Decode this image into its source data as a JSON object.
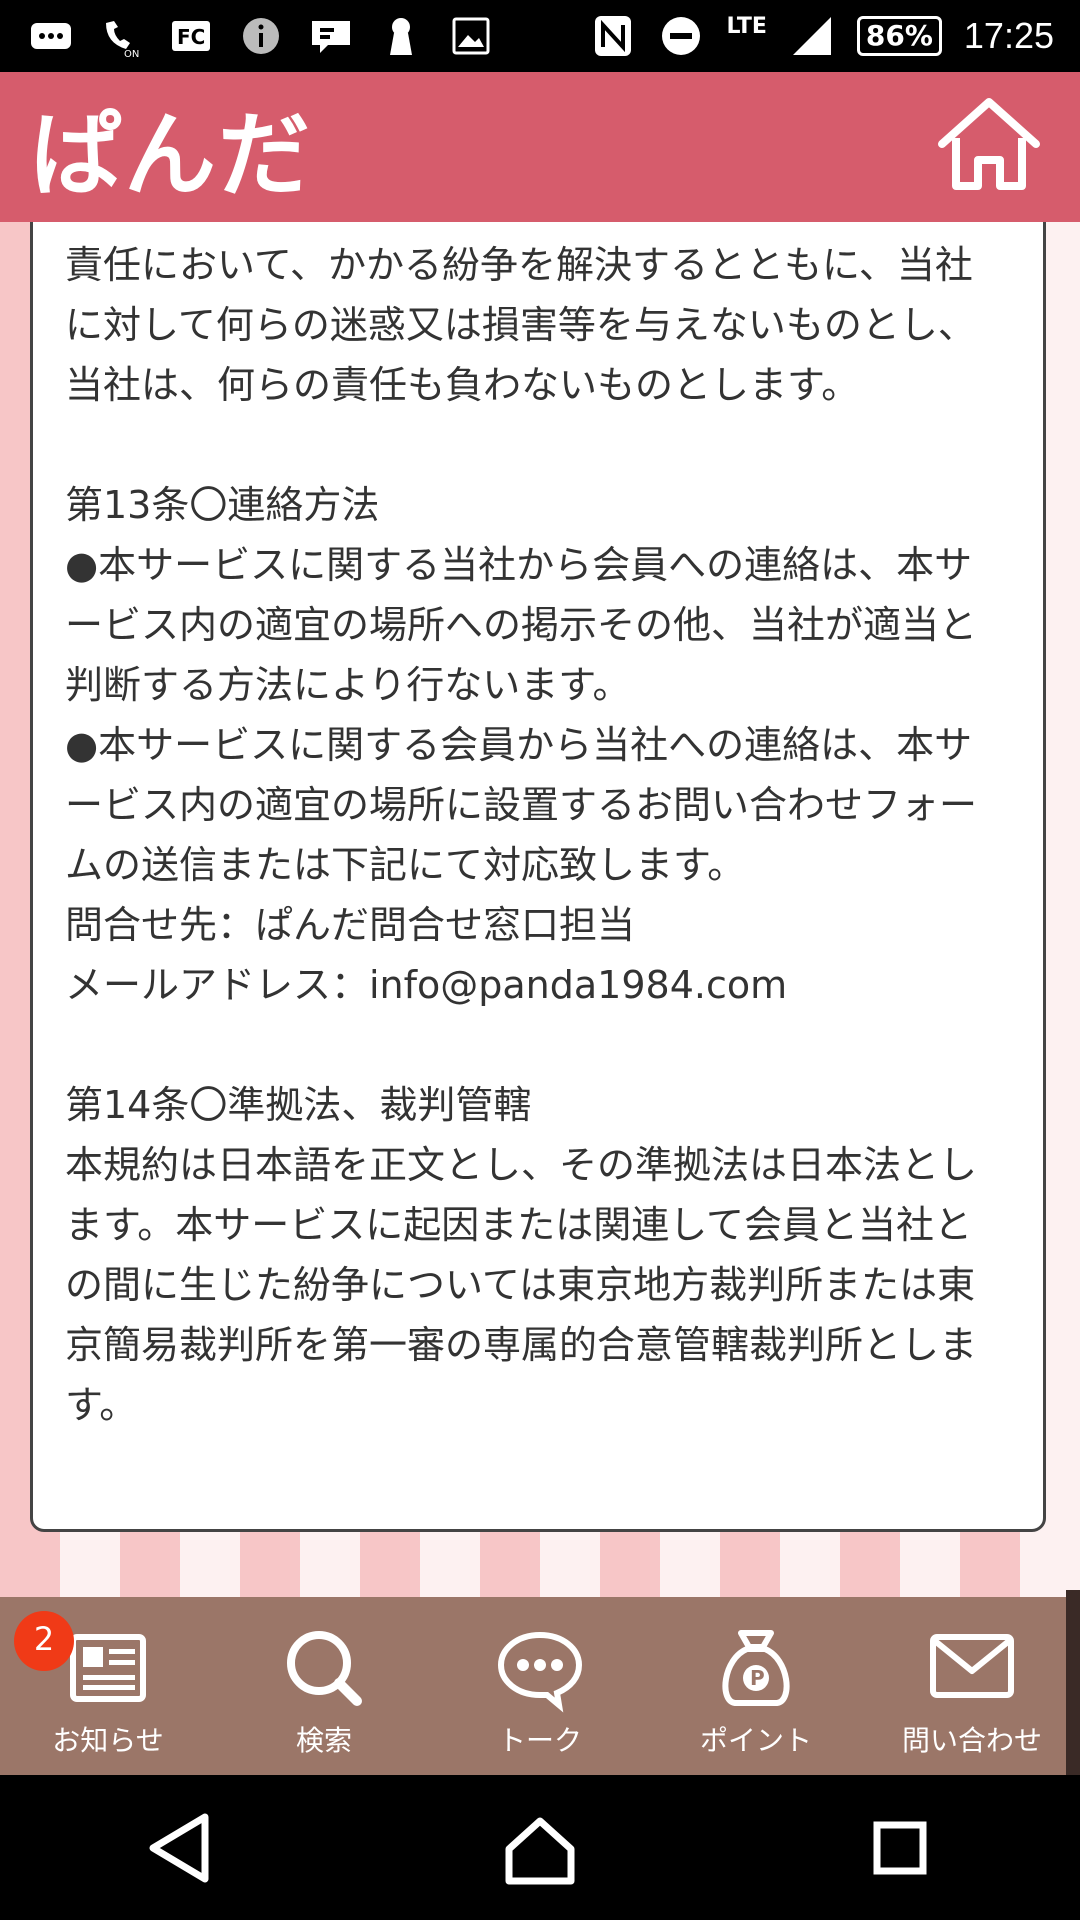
{
  "status_bar": {
    "icons": [
      "message-icon",
      "wifi-calling-icon",
      "fc-icon",
      "info-icon",
      "chat-icon",
      "keyhole-icon",
      "gallery-icon",
      "nfc-icon",
      "do-not-disturb-icon",
      "signal-icon"
    ],
    "network": "LTE",
    "battery": "86%",
    "time": "17:25"
  },
  "header": {
    "logo": "ぱんだ",
    "home_icon": "home-icon",
    "colors": {
      "header_bg": "#d65c6c"
    }
  },
  "content": {
    "paragraphs": [
      "責任において、かかる紛争を解決するとともに、当社に対して何らの迷惑又は損害等を与えないものとし、当社は、何らの責任も負わないものとします。",
      "",
      "第13条〇連絡方法",
      "●本サービスに関する当社から会員への連絡は、本サービス内の適宜の場所への掲示その他、当社が適当と判断する方法により行ないます。",
      "●本サービスに関する会員から当社への連絡は、本サービス内の適宜の場所に設置するお問い合わせフォームの送信または下記にて対応致します。",
      "問合せ先：ぱんだ問合せ窓口担当",
      "メールアドレス：info@panda1984.com",
      "",
      "第14条〇準拠法、裁判管轄",
      "本規約は日本語を正文とし、その準拠法は日本法とします。本サービスに起因または関連して会員と当社との間に生じた紛争については東京地方裁判所または東京簡易裁判所を第一審の専属的合意管轄裁判所とします。"
    ]
  },
  "bottom_nav": {
    "items": [
      {
        "label": "お知らせ",
        "icon": "news-icon",
        "badge": "2"
      },
      {
        "label": "検索",
        "icon": "search-icon"
      },
      {
        "label": "トーク",
        "icon": "chat-bubble-icon"
      },
      {
        "label": "ポイント",
        "icon": "point-bag-icon"
      },
      {
        "label": "問い合わせ",
        "icon": "mail-icon"
      }
    ],
    "colors": {
      "bg": "#9b7668",
      "badge": "#f03a17"
    }
  },
  "system_nav": {
    "buttons": [
      "back-icon",
      "home-circle-icon",
      "recents-icon"
    ]
  }
}
